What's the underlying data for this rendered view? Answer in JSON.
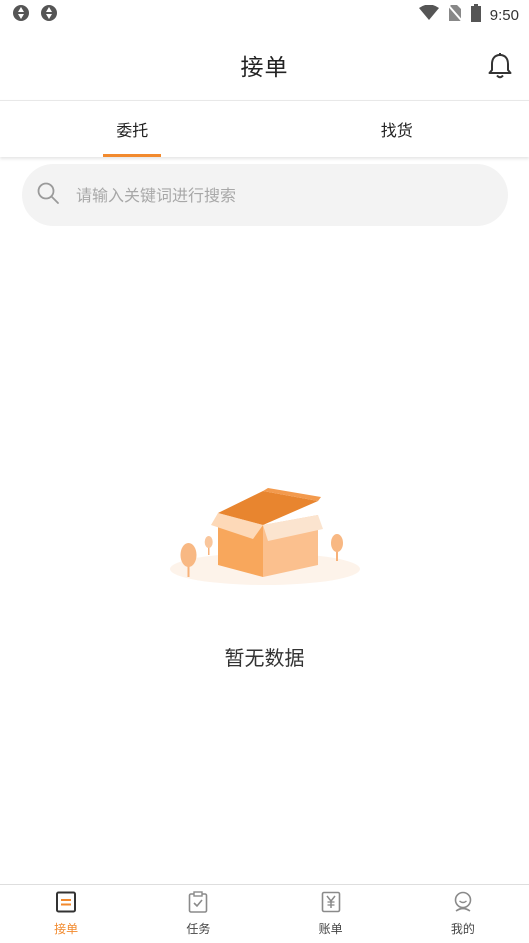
{
  "status_bar": {
    "time": "9:50",
    "left_icons": [
      "sync-icon",
      "sync-icon"
    ],
    "right_icons": [
      "wifi-icon",
      "no-sim-icon",
      "battery-icon"
    ]
  },
  "header": {
    "title": "接单",
    "bell_icon": "bell-icon"
  },
  "tabs": [
    {
      "label": "委托",
      "active": true
    },
    {
      "label": "找货",
      "active": false
    }
  ],
  "search": {
    "placeholder": "请输入关键词进行搜索",
    "value": ""
  },
  "empty_state": {
    "text": "暂无数据",
    "illustration": "empty-box-icon"
  },
  "bottom_nav": [
    {
      "label": "接单",
      "icon": "list-doc-icon",
      "active": true
    },
    {
      "label": "任务",
      "icon": "clipboard-check-icon",
      "active": false
    },
    {
      "label": "账单",
      "icon": "yen-doc-icon",
      "active": false
    },
    {
      "label": "我的",
      "icon": "profile-icon",
      "active": false
    }
  ],
  "colors": {
    "accent": "#f28a2e",
    "search_bg": "#f3f3f3",
    "inactive_icon": "#8a8a8a"
  }
}
